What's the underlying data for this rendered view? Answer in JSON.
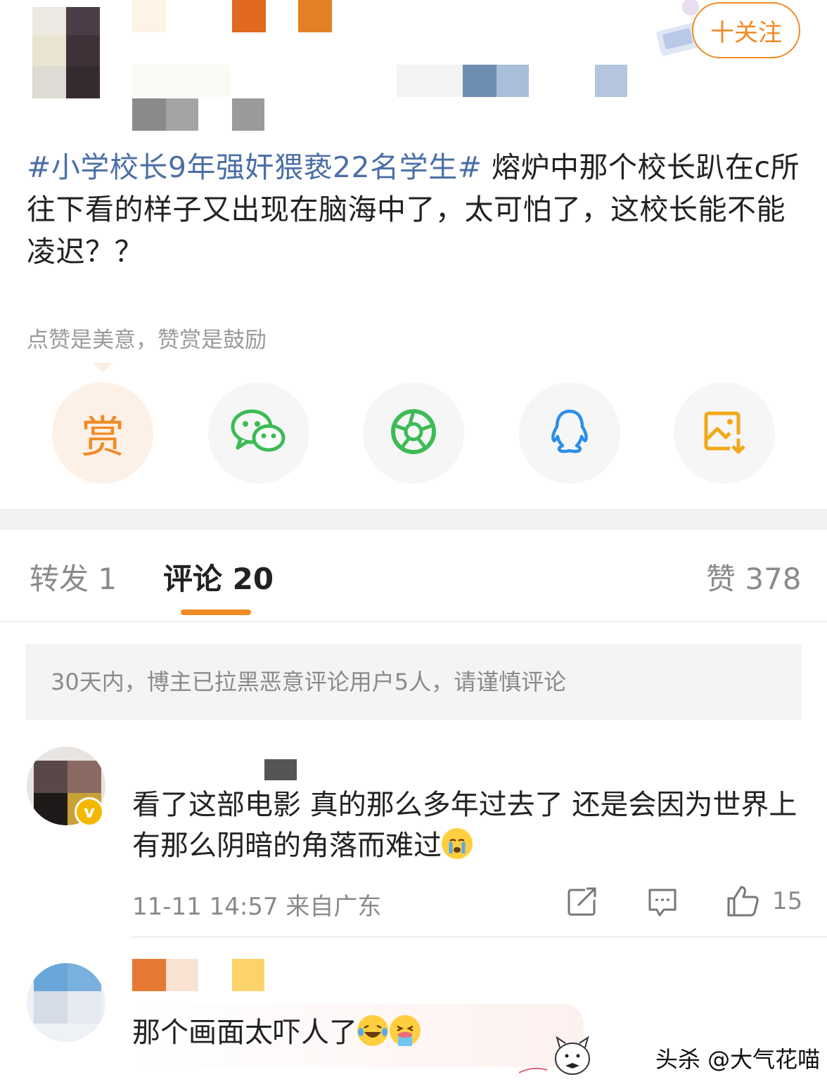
{
  "header": {
    "follow_label": "十关注"
  },
  "post": {
    "hashtag": "#小学校长9年强奸猥亵22名学生#",
    "body": " 熔炉中那个校长趴在c所往下看的样子又出现在脑海中了，太可怕了，这校长能不能凌迟？？"
  },
  "reward_hint": "点赞是美意，赞赏是鼓励",
  "share": {
    "reward_label": "赏",
    "icons": [
      "reward-icon",
      "wechat-icon",
      "moments-icon",
      "qq-icon",
      "save-image-icon"
    ]
  },
  "tabs": [
    {
      "label": "转发 1"
    },
    {
      "label": "评论 20"
    },
    {
      "label": "赞 378"
    }
  ],
  "notice": "30天内，博主已拉黑恶意评论用户5人，请谨慎评论",
  "comments": [
    {
      "text": "看了这部电影 真的那么多年过去了 还是会因为世界上有那么阴暗的角落而难过",
      "meta": "11-11 14:57 来自广东",
      "likes": "15",
      "verified": true
    },
    {
      "text": "那个画面太吓人了"
    }
  ],
  "watermark": "头杀 @大气花喵",
  "colors": {
    "accent": "#f08a24",
    "hashtag": "#4b6fa6",
    "reward_bg": "#fdf0e6"
  }
}
